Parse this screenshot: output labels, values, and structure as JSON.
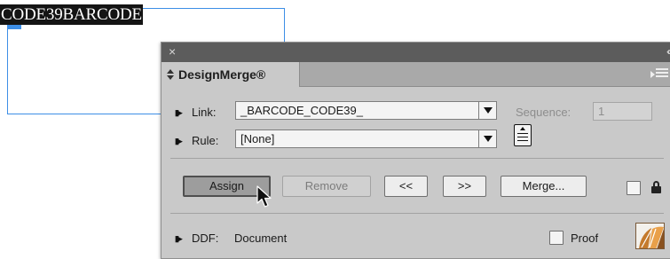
{
  "document": {
    "selected_text": "CODE39BARCODE"
  },
  "panel": {
    "close_glyph": "×",
    "collapse_glyph": "‹‹",
    "title": "DesignMerge®",
    "link": {
      "icon": "field-toggle-icon",
      "label": "Link:",
      "value": "_BARCODE_CODE39_"
    },
    "sequence": {
      "label": "Sequence:",
      "value": "1"
    },
    "rule": {
      "icon": "field-toggle-icon",
      "label": "Rule:",
      "value": "[None]"
    },
    "buttons": {
      "assign": "Assign",
      "remove": "Remove",
      "prev": "<<",
      "next": ">>",
      "merge": "Merge..."
    },
    "ddf": {
      "icon": "field-toggle-icon",
      "label": "DDF:",
      "value": "Document"
    },
    "proof_label": "Proof",
    "icons": {
      "row_marker": "▮▸"
    }
  }
}
